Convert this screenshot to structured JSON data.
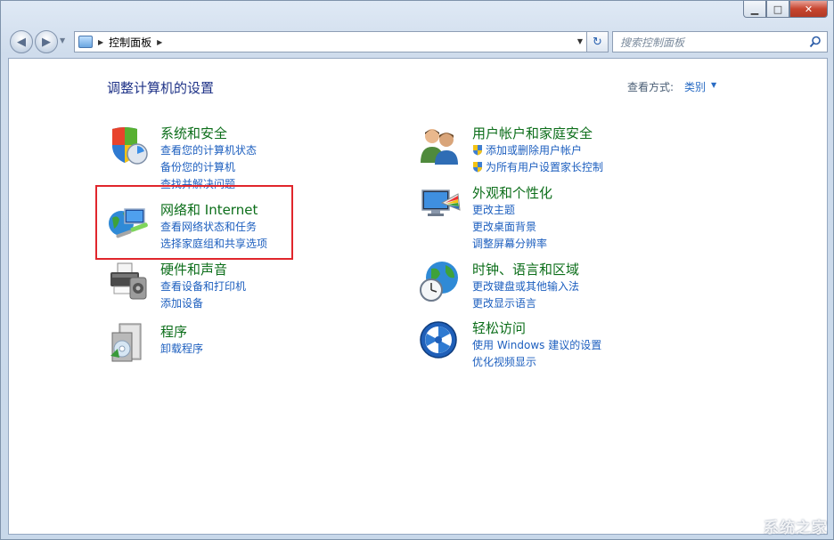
{
  "window": {
    "minimize": "▁",
    "maximize": "□",
    "close": "✕"
  },
  "address": {
    "path": "控制面板"
  },
  "search": {
    "placeholder": "搜索控制面板"
  },
  "header": {
    "title": "调整计算机的设置",
    "view_by_label": "查看方式:",
    "view_by_value": "类别"
  },
  "categories": [
    {
      "title": "系统和安全",
      "links": [
        "查看您的计算机状态",
        "备份您的计算机",
        "查找并解决问题"
      ],
      "icon": "shield-security-icon"
    },
    {
      "title": "网络和 Internet",
      "links": [
        "查看网络状态和任务",
        "选择家庭组和共享选项"
      ],
      "icon": "network-globe-icon"
    },
    {
      "title": "硬件和声音",
      "links": [
        "查看设备和打印机",
        "添加设备"
      ],
      "icon": "printer-hardware-icon"
    },
    {
      "title": "程序",
      "links": [
        "卸载程序"
      ],
      "icon": "programs-icon"
    },
    {
      "title": "用户帐户和家庭安全",
      "links": [
        "添加或删除用户帐户",
        "为所有用户设置家长控制"
      ],
      "icon": "users-icon"
    },
    {
      "title": "外观和个性化",
      "links": [
        "更改主题",
        "更改桌面背景",
        "调整屏幕分辨率"
      ],
      "icon": "monitor-palette-icon"
    },
    {
      "title": "时钟、语言和区域",
      "links": [
        "更改键盘或其他输入法",
        "更改显示语言"
      ],
      "icon": "globe-clock-icon"
    },
    {
      "title": "轻松访问",
      "links": [
        "使用 Windows 建议的设置",
        "优化视频显示"
      ],
      "icon": "ease-of-access-icon"
    }
  ],
  "watermark": "系统之家",
  "colors": {
    "link": "#1d5fbf",
    "category_title": "#0c6e1a",
    "page_title": "#1e3287",
    "highlight": "#e0262c"
  }
}
